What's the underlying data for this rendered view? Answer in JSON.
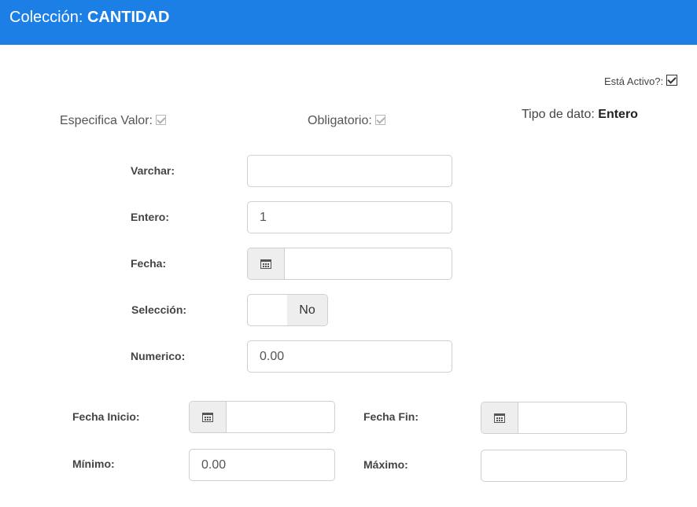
{
  "header": {
    "prefix": "Colección:",
    "name": "CANTIDAD"
  },
  "status": {
    "active_label": "Está Activo?:",
    "active_checked": true
  },
  "flags": {
    "specifies_value_label": "Especifica Valor:",
    "mandatory_label": "Obligatorio:",
    "data_type_label": "Tipo de dato:",
    "data_type_value": "Entero"
  },
  "fields": {
    "varchar_label": "Varchar:",
    "varchar_value": "",
    "entero_label": "Entero:",
    "entero_value": "1",
    "fecha_label": "Fecha:",
    "fecha_value": "",
    "seleccion_label": "Selección:",
    "seleccion_value": "No",
    "numerico_label": "Numerico:",
    "numerico_value": "0.00"
  },
  "range": {
    "fecha_inicio_label": "Fecha Inicio:",
    "fecha_inicio_value": "",
    "fecha_fin_label": "Fecha Fin:",
    "fecha_fin_value": "",
    "minimo_label": "Mínimo:",
    "minimo_value": "0.00",
    "maximo_label": "Máximo:",
    "maximo_value": ""
  },
  "icons": {
    "calendar": "calendar-icon",
    "check": "checkbox-check-icon"
  },
  "colors": {
    "header_bg": "#1b7fe6",
    "addon_bg": "#eeeeee"
  }
}
